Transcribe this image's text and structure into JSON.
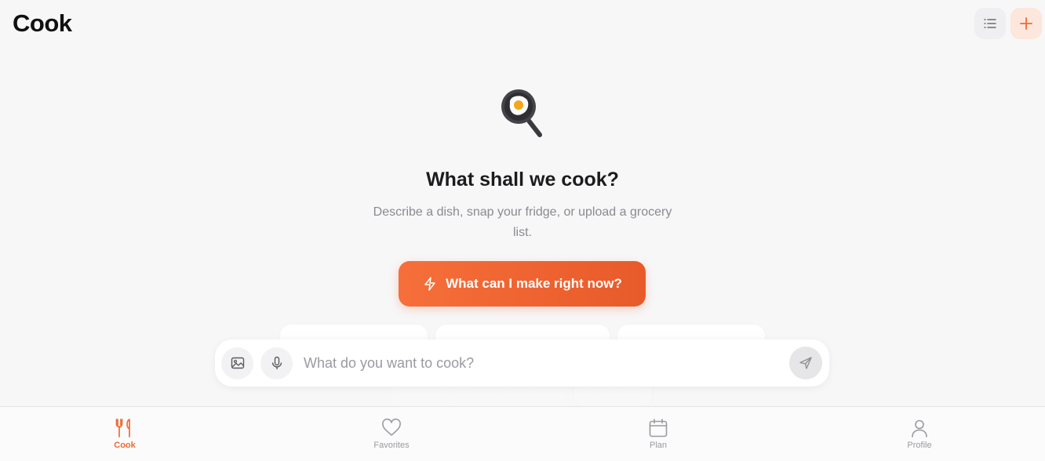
{
  "app": {
    "title": "Cook"
  },
  "header": {
    "icons": {
      "list": "list-icon",
      "add": "plus-icon"
    },
    "accent": "#ef6a35"
  },
  "hero": {
    "icon": "frying-pan-egg-icon",
    "title": "What shall we cook?",
    "subtitle": "Describe a dish, snap your fridge, or upload a grocery list."
  },
  "cta": {
    "label": "What can I make right now?",
    "icon": "lightning-icon"
  },
  "composer": {
    "placeholder": "What do you want to cook?",
    "icons": {
      "image": "image-icon",
      "mic": "microphone-icon",
      "send": "send-icon"
    }
  },
  "tabs": [
    {
      "label": "Cook",
      "icon": "fork-knife-icon",
      "active": true
    },
    {
      "label": "Favorites",
      "icon": "heart-icon",
      "active": false
    },
    {
      "label": "Plan",
      "icon": "calendar-icon",
      "active": false
    },
    {
      "label": "Profile",
      "icon": "person-icon",
      "active": false
    }
  ]
}
